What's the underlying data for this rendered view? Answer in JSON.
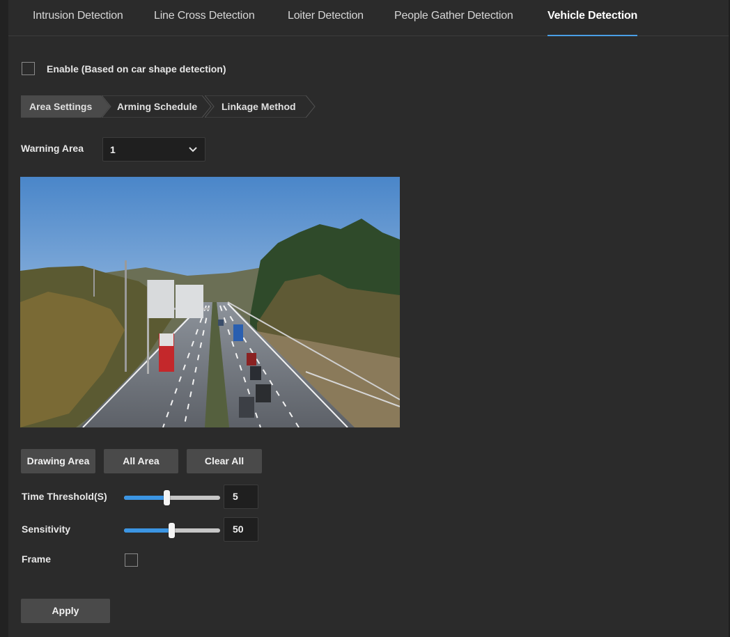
{
  "tabs": [
    {
      "label": "Intrusion Detection"
    },
    {
      "label": "Line Cross Detection"
    },
    {
      "label": "Loiter Detection"
    },
    {
      "label": "People Gather Detection"
    },
    {
      "label": "Vehicle Detection"
    }
  ],
  "active_tab": "Vehicle Detection",
  "enable": {
    "label": "Enable (Based on car shape detection)",
    "checked": false
  },
  "steps": [
    {
      "label": "Area Settings",
      "active": true
    },
    {
      "label": "Arming Schedule",
      "active": false
    },
    {
      "label": "Linkage Method",
      "active": false
    }
  ],
  "warning_area": {
    "label": "Warning Area",
    "value": "1"
  },
  "area_buttons": {
    "drawing": "Drawing Area",
    "all": "All Area",
    "clear": "Clear All"
  },
  "time_threshold": {
    "label": "Time Threshold(S)",
    "value": "5",
    "level_fraction": 0.45
  },
  "sensitivity": {
    "label": "Sensitivity",
    "value": "50",
    "level_fraction": 0.5
  },
  "frame": {
    "label": "Frame",
    "checked": false
  },
  "apply_label": "Apply",
  "colors": {
    "accent": "#3b95e3",
    "background": "#2b2b2b",
    "button": "#4a4a4a"
  }
}
